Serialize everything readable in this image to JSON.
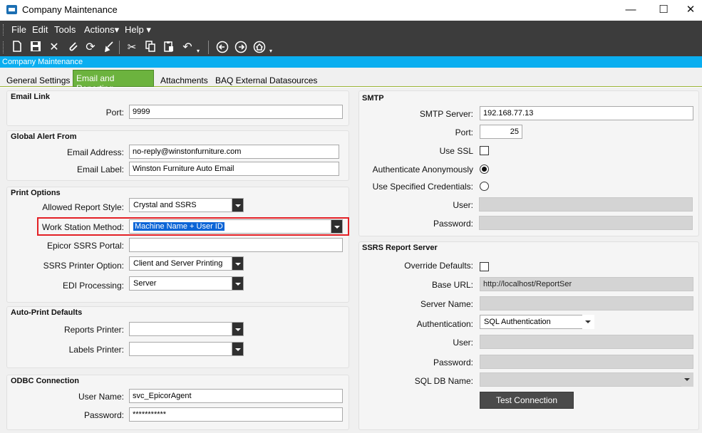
{
  "window": {
    "title": "Company Maintenance",
    "controls": {
      "minimize": "—",
      "maximize": "☐",
      "close": "✕"
    }
  },
  "menu": {
    "items": [
      "File",
      "Edit",
      "Tools",
      "Actions▾",
      "Help ▾"
    ]
  },
  "toolbar": {
    "icons": [
      "new-icon",
      "save-icon",
      "delete-icon",
      "attach-icon",
      "refresh-icon",
      "clear-icon",
      "cut-icon",
      "copy-icon",
      "paste-icon",
      "undo-icon",
      "back-icon",
      "forward-icon",
      "home-icon"
    ]
  },
  "header": {
    "title": "Company Maintenance"
  },
  "tabs": [
    {
      "label": "General Settings",
      "active": false
    },
    {
      "label": "Email and Reporting",
      "active": true
    },
    {
      "label": "Attachments",
      "active": false
    },
    {
      "label": "BAQ External Datasources",
      "active": false
    }
  ],
  "email_link": {
    "title": "Email Link",
    "port_label": "Port:",
    "port_value": "9999"
  },
  "global_alert": {
    "title": "Global Alert From",
    "address_label": "Email Address:",
    "address_value": "no-reply@winstonfurniture.com",
    "email_label_label": "Email Label:",
    "email_label_value": "Winston Furniture Auto Email"
  },
  "print_options": {
    "title": "Print Options",
    "report_style_label": "Allowed Report Style:",
    "report_style_value": "Crystal and SSRS",
    "workstation_label": "Work Station Method:",
    "workstation_value": "Machine Name + User ID",
    "ssrs_portal_label": "Epicor SSRS Portal:",
    "ssrs_portal_value": "",
    "printer_option_label": "SSRS Printer Option:",
    "printer_option_value": "Client and Server Printing",
    "edi_label": "EDI Processing:",
    "edi_value": "Server"
  },
  "auto_print": {
    "title": "Auto-Print Defaults",
    "reports_label": "Reports Printer:",
    "reports_value": "",
    "labels_label": "Labels Printer:",
    "labels_value": ""
  },
  "odbc": {
    "title": "ODBC Connection",
    "user_label": "User Name:",
    "user_value": "svc_EpicorAgent",
    "password_label": "Password:",
    "password_value": "***********"
  },
  "smtp": {
    "title": "SMTP",
    "server_label": "SMTP Server:",
    "server_value": "192.168.77.13",
    "port_label": "Port:",
    "port_value": "25",
    "ssl_label": "Use SSL",
    "anon_label": "Authenticate Anonymously",
    "creds_label": "Use Specified Credentials:",
    "user_label": "User:",
    "password_label": "Password:"
  },
  "ssrs_server": {
    "title": "SSRS Report Server",
    "override_label": "Override Defaults:",
    "base_url_label": "Base URL:",
    "base_url_value": "http://localhost/ReportSer",
    "server_name_label": "Server Name:",
    "auth_label": "Authentication:",
    "auth_value": "SQL Authentication",
    "user_label": "User:",
    "password_label": "Password:",
    "db_label": "SQL DB Name:",
    "test_button": "Test Connection"
  }
}
